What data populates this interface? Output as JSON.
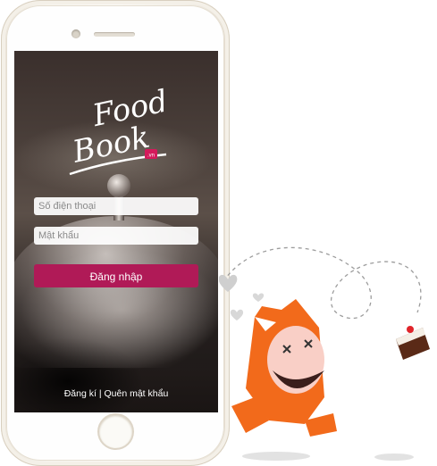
{
  "logo": {
    "line1": "Food",
    "line2": "Book",
    "badge": ".vn"
  },
  "form": {
    "phone_placeholder": "Số điện thoại",
    "password_placeholder": "Mật khẩu",
    "login_label": "Đăng nhập"
  },
  "footer": {
    "register_label": "Đăng kí",
    "separator": "|",
    "forgot_label": "Quên mật khẩu"
  },
  "colors": {
    "accent": "#b01a57",
    "mascot_orange": "#f26a1b"
  },
  "icons": [
    "heart-icon",
    "cake-icon",
    "mascot-cat"
  ]
}
